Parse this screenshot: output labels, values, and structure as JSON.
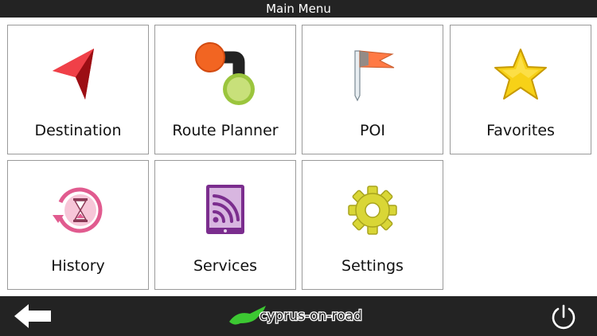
{
  "window": {
    "title": "Main Menu"
  },
  "menu": {
    "tiles": [
      {
        "label": "Destination",
        "icon": "destination-arrow-icon"
      },
      {
        "label": "Route Planner",
        "icon": "route-planner-icon"
      },
      {
        "label": "POI",
        "icon": "poi-flag-icon"
      },
      {
        "label": "Favorites",
        "icon": "star-icon"
      },
      {
        "label": "History",
        "icon": "history-hourglass-icon"
      },
      {
        "label": "Services",
        "icon": "services-tablet-icon"
      },
      {
        "label": "Settings",
        "icon": "gear-icon"
      }
    ]
  },
  "footer": {
    "logo_text": "cyprus-on-road",
    "back_icon": "back-arrow-icon",
    "power_icon": "power-icon"
  },
  "colors": {
    "bar": "#232323",
    "destination_red": "#d01a22",
    "route_orange": "#f26522",
    "route_green": "#9bc53d",
    "poi_flag": "#ff7a45",
    "star_yellow": "#f7d117",
    "history_pink": "#e15b8f",
    "services_purple": "#7b2d8e",
    "settings_yellow": "#d9d636",
    "logo_green": "#3cc832"
  }
}
